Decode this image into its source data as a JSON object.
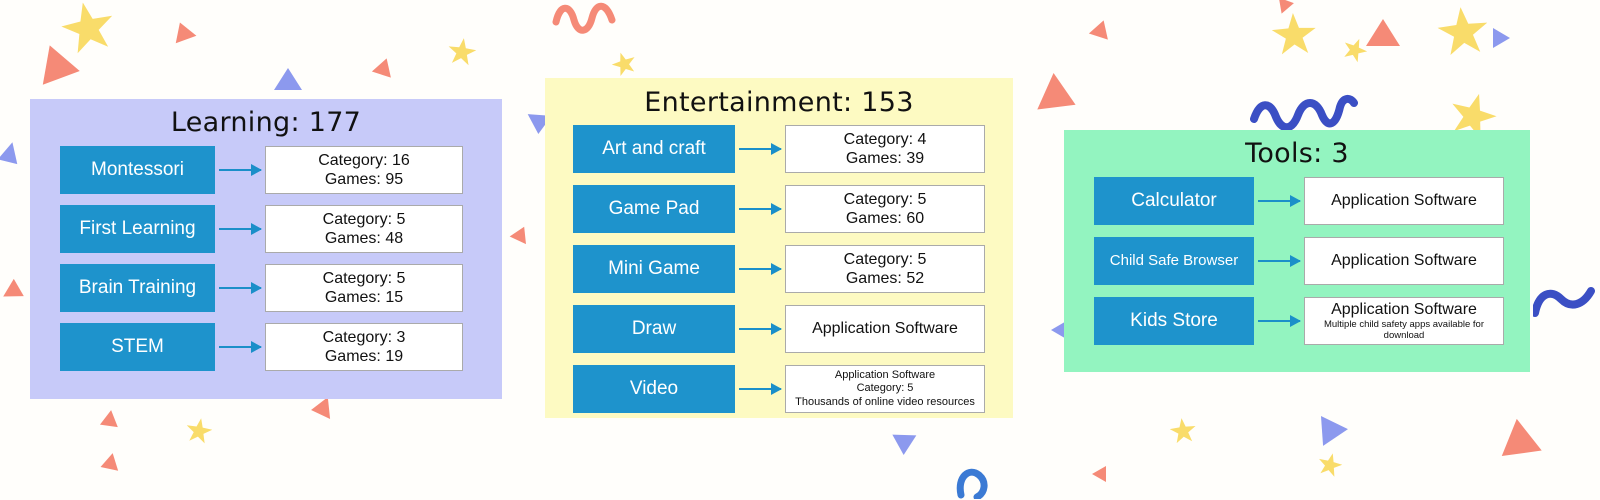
{
  "colors": {
    "node_blue": "#1e93cc",
    "arrow_blue": "#1b8fc9",
    "learning_panel": "#c7caf9",
    "entertainment_panel": "#fdfac2",
    "tools_panel": "#93f4c0",
    "confetti_yellow": "#f9dc6a",
    "confetti_coral": "#f88b77",
    "confetti_periwinkle": "#8c99ee",
    "confetti_blue": "#3b4fc4",
    "detail_box": "#ffffff"
  },
  "panels": [
    {
      "id": "learning",
      "title": "Learning: 177",
      "rows": [
        {
          "node": "Montessori",
          "lines": [
            "Category: 16",
            "Games: 95"
          ]
        },
        {
          "node": "First Learning",
          "lines": [
            "Category: 5",
            "Games: 48"
          ]
        },
        {
          "node": "Brain Training",
          "lines": [
            "Category: 5",
            "Games: 15"
          ]
        },
        {
          "node": "STEM",
          "lines": [
            "Category: 3",
            "Games: 19"
          ]
        }
      ]
    },
    {
      "id": "entertainment",
      "title": "Entertainment: 153",
      "rows": [
        {
          "node": "Art and craft",
          "lines": [
            "Category: 4",
            "Games: 39"
          ]
        },
        {
          "node": "Game Pad",
          "lines": [
            "Category: 5",
            "Games: 60"
          ]
        },
        {
          "node": "Mini Game",
          "lines": [
            "Category: 5",
            "Games: 52"
          ]
        },
        {
          "node": "Draw",
          "lines": [
            "Application Software"
          ]
        },
        {
          "node": "Video",
          "lines": [
            "Application Software",
            "Category: 5",
            "Thousands of online video resources"
          ]
        }
      ]
    },
    {
      "id": "tools",
      "title": "Tools: 3",
      "rows": [
        {
          "node": "Calculator",
          "lines": [
            "Application Software"
          ]
        },
        {
          "node": "Child Safe Browser",
          "lines": [
            "Application Software"
          ]
        },
        {
          "node": "Kids Store",
          "lines": [
            "Application Software"
          ],
          "sub": "Multiple child safety apps available for download"
        }
      ]
    }
  ]
}
